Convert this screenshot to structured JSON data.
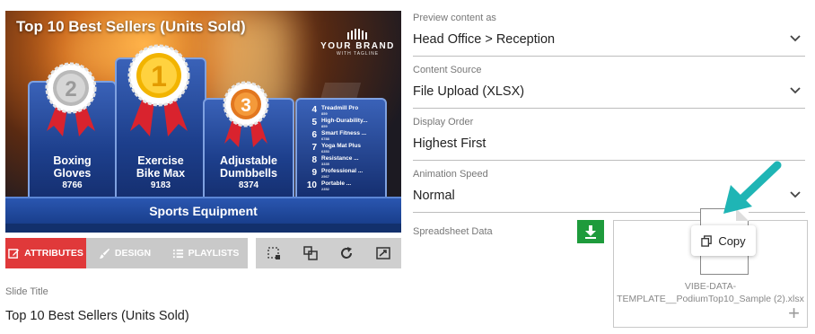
{
  "preview": {
    "title": "Top 10 Best Sellers (Units Sold)",
    "brand_name": "YOUR BRAND",
    "brand_tagline": "WITH TAGLINE",
    "podium": [
      {
        "rank": "2",
        "name_line1": "Boxing",
        "name_line2": "Gloves",
        "value": "8766",
        "medal": "silver"
      },
      {
        "rank": "1",
        "name_line1": "Exercise",
        "name_line2": "Bike Max",
        "value": "9183",
        "medal": "gold"
      },
      {
        "rank": "3",
        "name_line1": "Adjustable",
        "name_line2": "Dumbbells",
        "value": "8374",
        "medal": "bronze"
      }
    ],
    "list": [
      {
        "rank": "4",
        "name": "Treadmill Pro",
        "value": "859"
      },
      {
        "rank": "5",
        "name": "High-Durability...",
        "value": "859"
      },
      {
        "rank": "6",
        "name": "Smart Fitness ...",
        "value": "6788"
      },
      {
        "rank": "7",
        "name": "Yoga Mat Plus",
        "value": "6353"
      },
      {
        "rank": "8",
        "name": "Resistance ...",
        "value": "3335"
      },
      {
        "rank": "9",
        "name": "Professional ...",
        "value": "2567"
      },
      {
        "rank": "10",
        "name": "Portable ...",
        "value": "2352"
      }
    ],
    "category": "Sports Equipment"
  },
  "tabs": [
    {
      "label": "ATTRIBUTES",
      "icon": "edit-icon",
      "active": true
    },
    {
      "label": "DESIGN",
      "icon": "brush-icon",
      "active": false
    },
    {
      "label": "PLAYLISTS",
      "icon": "list-icon",
      "active": false
    }
  ],
  "toolbar_icons": [
    "crop-icon",
    "layers-icon",
    "refresh-icon",
    "resize-icon"
  ],
  "form": {
    "preview_as": {
      "label": "Preview content as",
      "value": "Head Office > Reception"
    },
    "content_source": {
      "label": "Content Source",
      "value": "File Upload (XLSX)"
    },
    "display_order": {
      "label": "Display Order",
      "value": "Highest First"
    },
    "animation_speed": {
      "label": "Animation Speed",
      "value": "Normal"
    },
    "spreadsheet": {
      "label": "Spreadsheet Data",
      "file_line1": "VIBE-DATA-",
      "file_line2": "TEMPLATE__PodiumTop10_Sample (2).xlsx"
    },
    "copy_label": "Copy"
  },
  "slide_title": {
    "label": "Slide Title",
    "value": "Top 10 Best Sellers (Units Sold)"
  },
  "colors": {
    "accent_red": "#e0393a",
    "download_green": "#1e9b3c",
    "arrow_teal": "#1fb5b5"
  }
}
